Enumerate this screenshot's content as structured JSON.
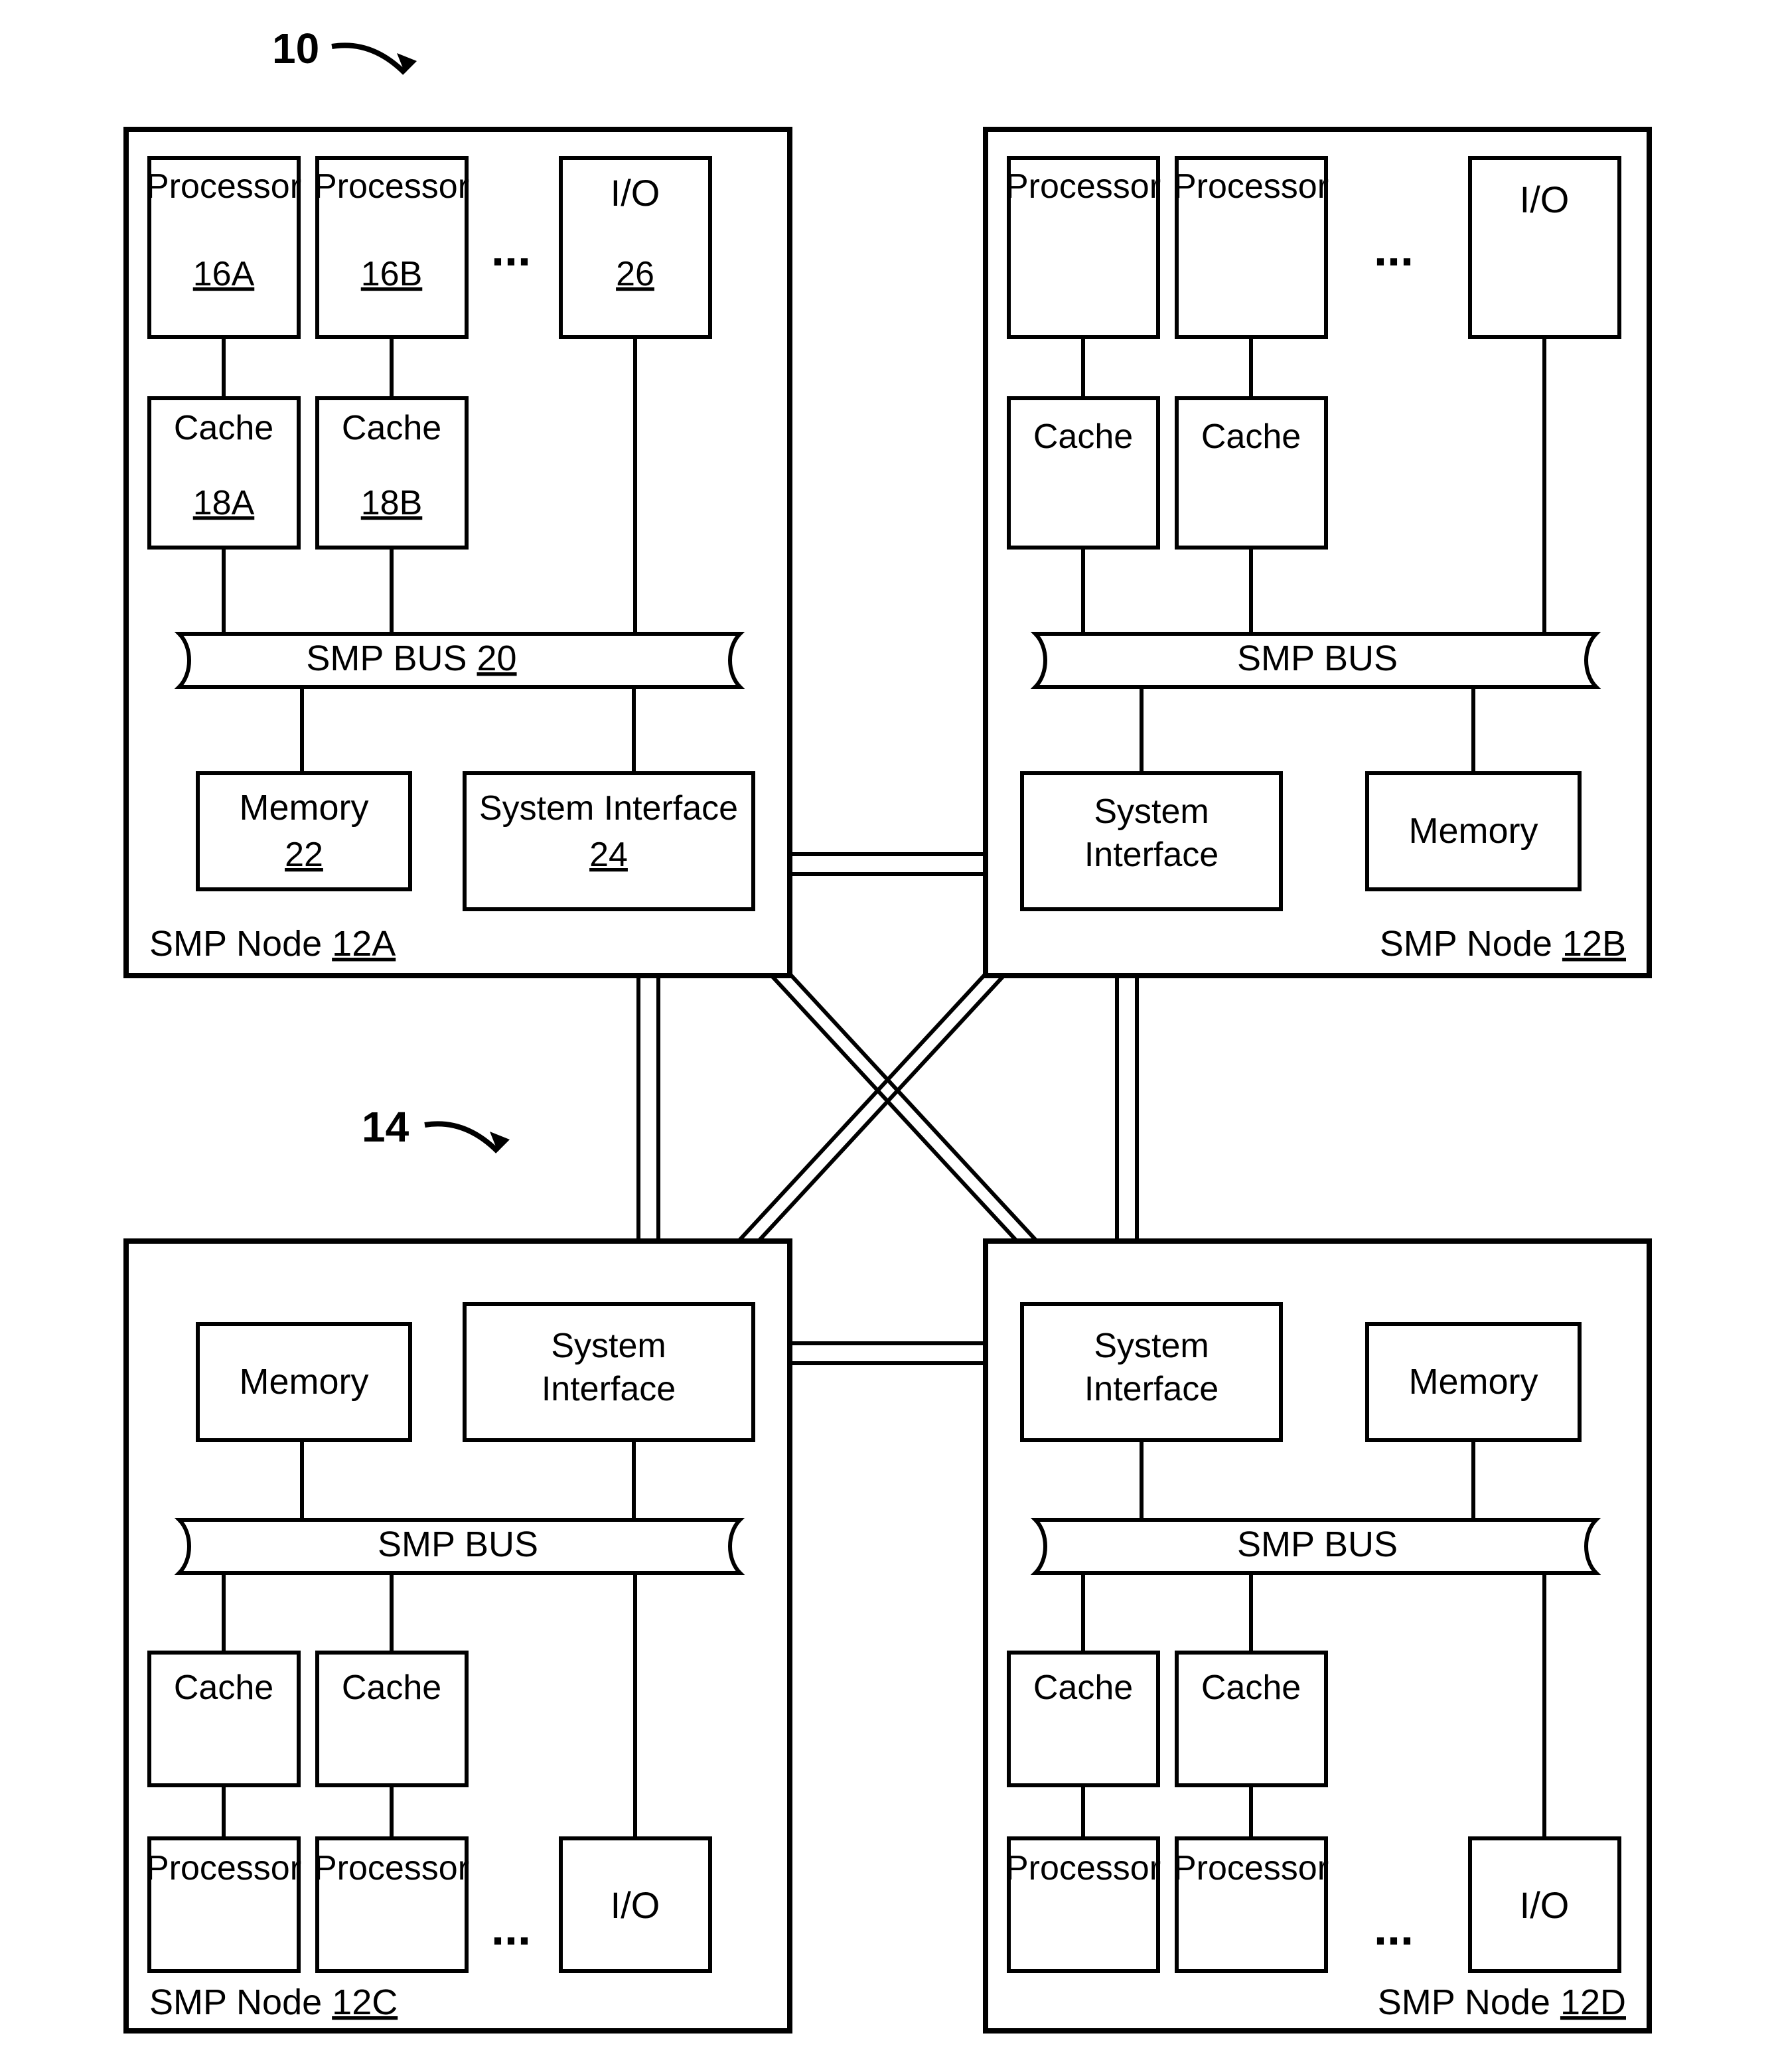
{
  "figure_ref": "10",
  "interconnect_ref": "14",
  "nodes": {
    "a": {
      "label_prefix": "SMP Node",
      "label_ref": "12A",
      "processor_label": "Processor",
      "proc_a_ref": "16A",
      "proc_b_ref": "16B",
      "io_label": "I/O",
      "io_ref": "26",
      "cache_label": "Cache",
      "cache_a_ref": "18A",
      "cache_b_ref": "18B",
      "bus_label": "SMP BUS",
      "bus_ref": "20",
      "memory_label": "Memory",
      "memory_ref": "22",
      "sysif_label": "System Interface",
      "sysif_ref": "24",
      "ellipsis": "..."
    },
    "b": {
      "label_prefix": "SMP Node",
      "label_ref": "12B",
      "processor_label": "Processor",
      "io_label": "I/O",
      "cache_label": "Cache",
      "bus_label": "SMP BUS",
      "memory_label": "Memory",
      "sysif_line1": "System",
      "sysif_line2": "Interface",
      "ellipsis": "..."
    },
    "c": {
      "label_prefix": "SMP Node",
      "label_ref": "12C",
      "processor_label": "Processor",
      "io_label": "I/O",
      "cache_label": "Cache",
      "bus_label": "SMP BUS",
      "memory_label": "Memory",
      "sysif_line1": "System",
      "sysif_line2": "Interface",
      "ellipsis": "..."
    },
    "d": {
      "label_prefix": "SMP Node",
      "label_ref": "12D",
      "processor_label": "Processor",
      "io_label": "I/O",
      "cache_label": "Cache",
      "bus_label": "SMP BUS",
      "memory_label": "Memory",
      "sysif_line1": "System",
      "sysif_line2": "Interface",
      "ellipsis": "..."
    }
  }
}
